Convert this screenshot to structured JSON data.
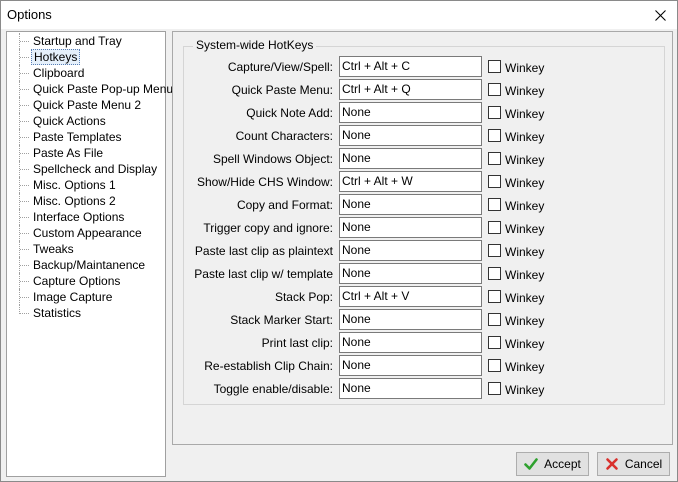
{
  "window": {
    "title": "Options"
  },
  "tree": {
    "items": [
      {
        "label": "Startup and Tray"
      },
      {
        "label": "Hotkeys"
      },
      {
        "label": "Clipboard"
      },
      {
        "label": "Quick Paste Pop-up Menu"
      },
      {
        "label": "Quick Paste Menu 2"
      },
      {
        "label": "Quick Actions"
      },
      {
        "label": "Paste Templates"
      },
      {
        "label": "Paste As File"
      },
      {
        "label": "Spellcheck and Display"
      },
      {
        "label": "Misc. Options 1"
      },
      {
        "label": "Misc. Options 2"
      },
      {
        "label": "Interface Options"
      },
      {
        "label": "Custom Appearance"
      },
      {
        "label": "Tweaks"
      },
      {
        "label": "Backup/Maintanence"
      },
      {
        "label": "Capture Options"
      },
      {
        "label": "Image Capture"
      },
      {
        "label": "Statistics"
      }
    ],
    "selected": "Hotkeys"
  },
  "hotkeys": {
    "group_title": "System-wide HotKeys",
    "winkey_label": "Winkey",
    "rows": [
      {
        "label": "Capture/View/Spell:",
        "value": "Ctrl + Alt + C"
      },
      {
        "label": "Quick Paste Menu:",
        "value": "Ctrl + Alt + Q"
      },
      {
        "label": "Quick Note Add:",
        "value": "None"
      },
      {
        "label": "Count Characters:",
        "value": "None"
      },
      {
        "label": "Spell Windows Object:",
        "value": "None"
      },
      {
        "label": "Show/Hide CHS Window:",
        "value": "Ctrl + Alt + W"
      },
      {
        "label": "Copy and Format:",
        "value": "None"
      },
      {
        "label": "Trigger copy and ignore:",
        "value": "None"
      },
      {
        "label": "Paste last clip as plaintext",
        "value": "None"
      },
      {
        "label": "Paste last clip w/ template",
        "value": "None"
      },
      {
        "label": "Stack Pop:",
        "value": "Ctrl + Alt + V"
      },
      {
        "label": "Stack Marker Start:",
        "value": "None"
      },
      {
        "label": "Print last clip:",
        "value": "None"
      },
      {
        "label": "Re-establish Clip Chain:",
        "value": "None"
      },
      {
        "label": "Toggle enable/disable:",
        "value": "None"
      }
    ]
  },
  "buttons": {
    "accept_label": "Accept",
    "cancel_label": "Cancel"
  },
  "colors": {
    "accept_icon": "#2ea12e",
    "cancel_icon": "#d9302c"
  }
}
